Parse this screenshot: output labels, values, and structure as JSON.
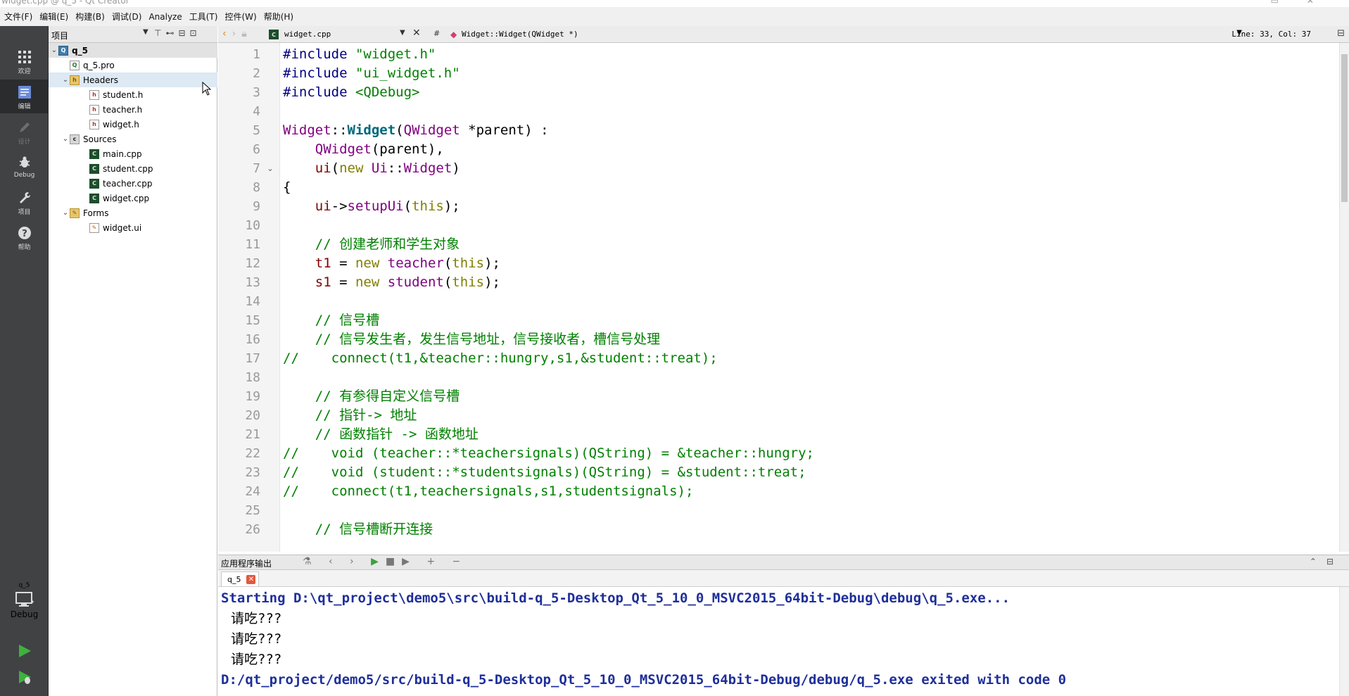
{
  "window": {
    "title": "widget.cpp @ q_5 - Qt Creator"
  },
  "menu": [
    "文件(F)",
    "编辑(E)",
    "构建(B)",
    "调试(D)",
    "Analyze",
    "工具(T)",
    "控件(W)",
    "帮助(H)"
  ],
  "modes": [
    {
      "label": "欢迎",
      "icon": "grid-icon",
      "active": false
    },
    {
      "label": "编辑",
      "icon": "edit-icon",
      "active": true
    },
    {
      "label": "设计",
      "icon": "pencil-icon",
      "active": false
    },
    {
      "label": "Debug",
      "icon": "bug-icon",
      "active": false
    },
    {
      "label": "项目",
      "icon": "wrench-icon",
      "active": false
    },
    {
      "label": "帮助",
      "icon": "help-icon",
      "active": false
    }
  ],
  "kit": {
    "project": "q_5",
    "label": "Debug"
  },
  "project_panel": {
    "title": "项目",
    "tree": [
      {
        "label": "q_5",
        "kind": "root",
        "depth": 0
      },
      {
        "label": "q_5.pro",
        "kind": "pro",
        "depth": 1
      },
      {
        "label": "Headers",
        "kind": "folder",
        "depth": 1
      },
      {
        "label": "student.h",
        "kind": "h",
        "depth": 2
      },
      {
        "label": "teacher.h",
        "kind": "h",
        "depth": 2
      },
      {
        "label": "widget.h",
        "kind": "h",
        "depth": 2
      },
      {
        "label": "Sources",
        "kind": "folder-src",
        "depth": 1
      },
      {
        "label": "main.cpp",
        "kind": "cpp",
        "depth": 2
      },
      {
        "label": "student.cpp",
        "kind": "cpp",
        "depth": 2
      },
      {
        "label": "teacher.cpp",
        "kind": "cpp",
        "depth": 2
      },
      {
        "label": "widget.cpp",
        "kind": "cpp",
        "depth": 2
      },
      {
        "label": "Forms",
        "kind": "folder",
        "depth": 1
      },
      {
        "label": "widget.ui",
        "kind": "ui",
        "depth": 2
      }
    ]
  },
  "editor_toolbar": {
    "file": "widget.cpp",
    "hash": "#",
    "symbol": "Widget::Widget(QWidget *)",
    "position": "Line: 33, Col: 37"
  },
  "code_lines": [
    "1",
    "2",
    "3",
    "4",
    "5",
    "6",
    "7",
    "8",
    "9",
    "10",
    "11",
    "12",
    "13",
    "14",
    "15",
    "16",
    "17",
    "18",
    "19",
    "20",
    "21",
    "22",
    "23",
    "24",
    "25",
    "26"
  ],
  "code_text": {
    "l1": [
      "#include ",
      "\"widget.h\""
    ],
    "l2": [
      "#include ",
      "\"ui_widget.h\""
    ],
    "l3": [
      "#include ",
      "<QDebug>"
    ],
    "l5": [
      "Widget",
      "::",
      "Widget",
      "(",
      "QWidget",
      " *parent) :"
    ],
    "l6": [
      "    ",
      "QWidget",
      "(parent),"
    ],
    "l7": [
      "    ",
      "ui",
      "(",
      "new",
      " ",
      "Ui",
      "::",
      "Widget",
      ")"
    ],
    "l8": "{",
    "l9": [
      "    ",
      "ui",
      "->",
      "setupUi",
      "(",
      "this",
      ");"
    ],
    "l11": "    // 创建老师和学生对象",
    "l12": [
      "    ",
      "t1",
      " = ",
      "new",
      " ",
      "teacher",
      "(",
      "this",
      ");"
    ],
    "l13": [
      "    ",
      "s1",
      " = ",
      "new",
      " ",
      "student",
      "(",
      "this",
      ");"
    ],
    "l15": "    // 信号槽",
    "l16": "    // 信号发生者，发生信号地址，信号接收者，槽信号处理",
    "l17": "//    connect(t1,&teacher::hungry,s1,&student::treat);",
    "l19": "    // 有参得自定义信号槽",
    "l20": "    // 指针-> 地址",
    "l21": "    // 函数指针 -> 函数地址",
    "l22": "//    void (teacher::*teachersignals)(QString) = &teacher::hungry;",
    "l23": "//    void (student::*studentsignals)(QString) = &student::treat;",
    "l24": "//    connect(t1,teachersignals,s1,studentsignals);",
    "l26": "    // 信号槽断开连接"
  },
  "output": {
    "title": "应用程序输出",
    "tab": "q_5",
    "lines": [
      "Starting D:\\qt_project\\demo5\\src\\build-q_5-Desktop_Qt_5_10_0_MSVC2015_64bit-Debug\\debug\\q_5.exe...",
      "请吃???",
      "请吃???",
      "请吃???",
      "D:/qt_project/demo5/src/build-q_5-Desktop_Qt_5_10_0_MSVC2015_64bit-Debug/debug/q_5.exe exited with code 0"
    ]
  }
}
